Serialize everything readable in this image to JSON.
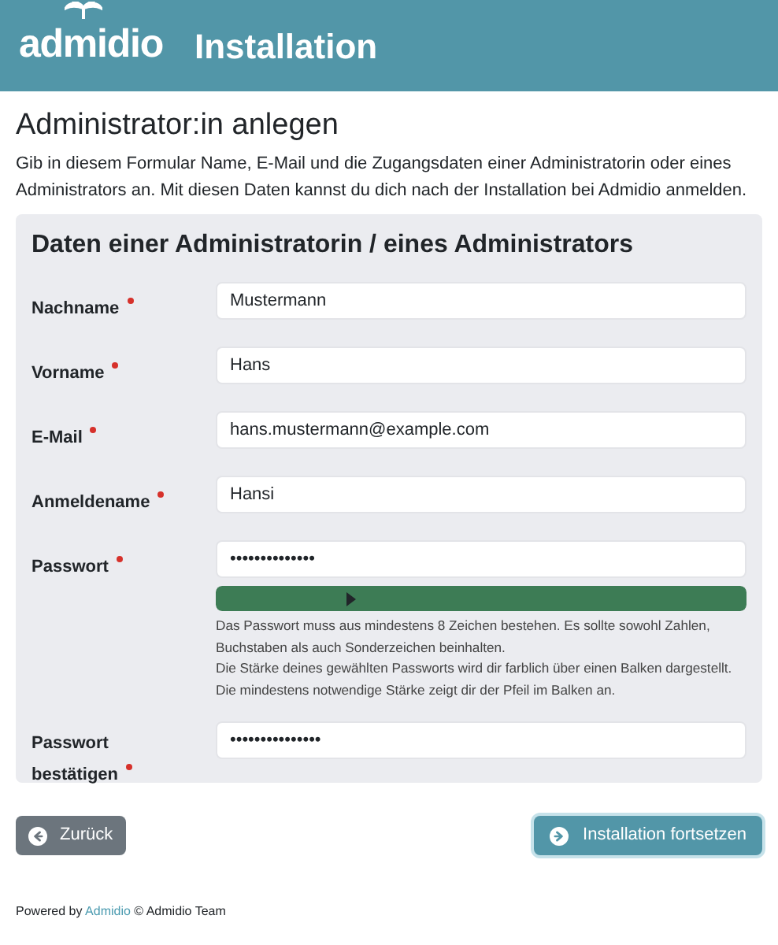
{
  "header": {
    "logo": "admidio",
    "title": "Installation"
  },
  "page": {
    "heading": "Administrator:in anlegen",
    "intro": "Gib in diesem Formular Name, E-Mail und die Zugangsdaten einer Administratorin oder eines Administrators an. Mit diesen Daten kannst du dich nach der Installation bei Admidio anmelden."
  },
  "card": {
    "title": "Daten einer Administratorin / eines Administrators",
    "fields": [
      {
        "label": "Nachname",
        "required": true,
        "value": "Mustermann",
        "kind": "text"
      },
      {
        "label": "Vorname",
        "required": true,
        "value": "Hans",
        "kind": "text"
      },
      {
        "label": "E-Mail",
        "required": true,
        "value": "hans.mustermann@example.com",
        "kind": "text"
      },
      {
        "label": "Anmeldename",
        "required": true,
        "value": "Hansi",
        "kind": "text"
      },
      {
        "label": "Passwort",
        "required": true,
        "value": "••••••••••••••",
        "kind": "password",
        "strength": {
          "level": 1.0
        },
        "help": [
          "Das Passwort muss aus mindestens 8 Zeichen bestehen. Es sollte sowohl Zahlen, Buchstaben als auch Sonderzeichen beinhalten.",
          "Die Stärke deines gewählten Passworts wird dir farblich über einen Balken dargestellt. Die mindestens notwendige Stärke zeigt dir der Pfeil im Balken an."
        ]
      },
      {
        "label": "Passwort bestätigen",
        "required": true,
        "value": "•••••••••••••••",
        "kind": "text"
      }
    ]
  },
  "buttons": [
    {
      "label": "Zurück",
      "kind": "back"
    },
    {
      "label": "Installation fortsetzen",
      "kind": "next"
    }
  ],
  "footer": {
    "prefix": "Powered by",
    "link": "Admidio",
    "suffix": "© Admidio Team"
  }
}
